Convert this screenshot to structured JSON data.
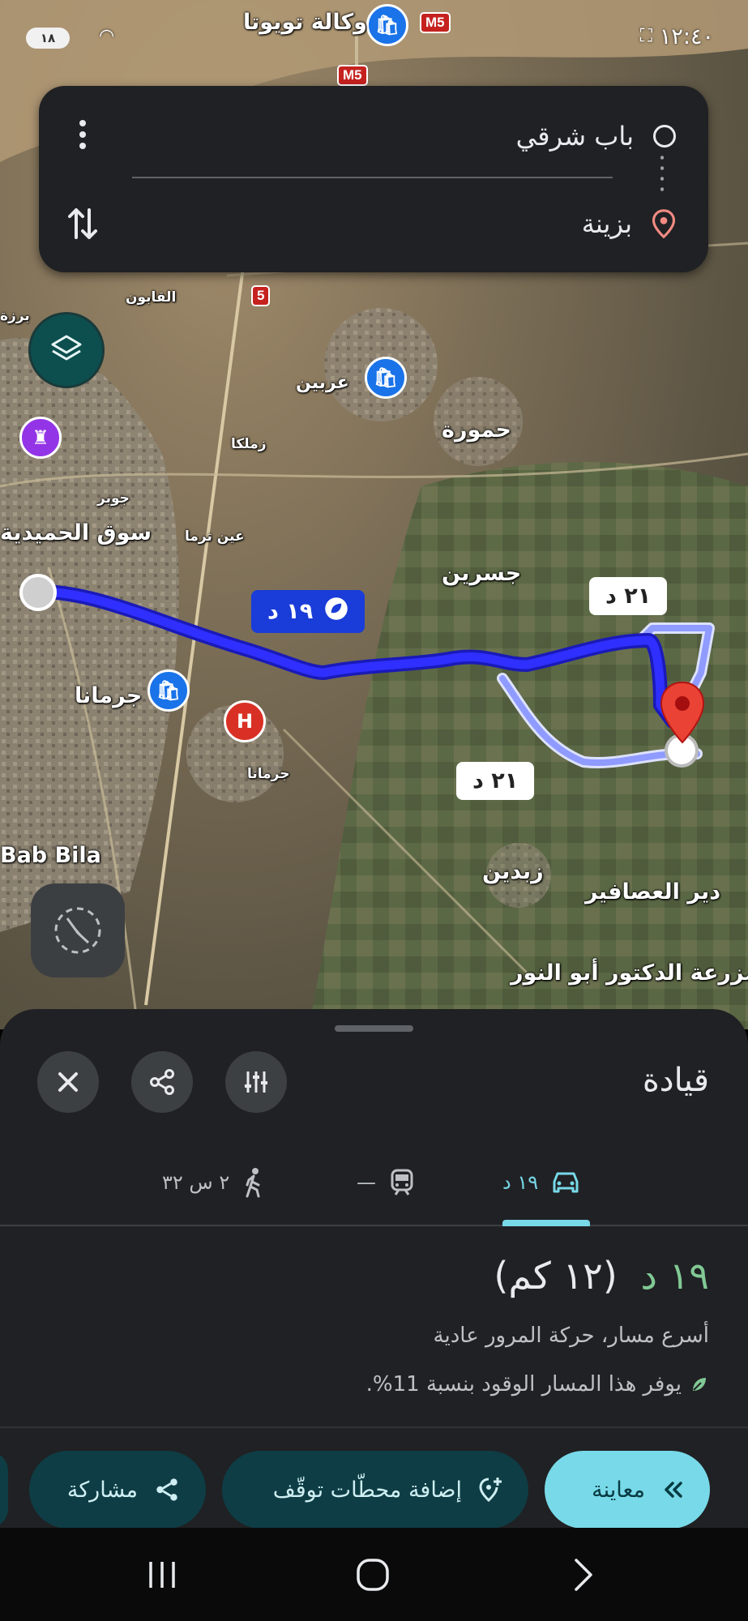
{
  "status_bar": {
    "time": "١٢:٤٠",
    "battery": "١٨"
  },
  "directions": {
    "origin": "باب شرقي",
    "destination": "بزينة",
    "more_icon": "more-vert-icon",
    "swap_icon": "swap-vertical-icon"
  },
  "map": {
    "labels": {
      "toyota": "وكالة تويوتا",
      "qaboun": "القابون",
      "arbeen": "عربين",
      "harasta": "حمورة",
      "zamalka": "زملكا",
      "jobar": "جوبر",
      "ain_tarma": "عين ترما",
      "hamidiyeh": "سوق الحميدية",
      "jisreen": "جسرين",
      "jaramana": "جرمانا",
      "jaramana_small": "جرمانا",
      "bab_bila": "Bab Bila",
      "zebdin": "زبدين",
      "deir_asafir": "دير العصافير",
      "abu_nour": "مزرعة الدكتور أبو النور",
      "barza": "برزة",
      "road_m5_top": "M5",
      "road_m5_mid": "M5",
      "road_5": "5"
    },
    "routes": {
      "main_time": "١٩ د",
      "alt_time_1": "٢١ د",
      "alt_time_2": "٢١ د"
    },
    "route_color": "#1a1ae0",
    "alt_route_color": "#8f9bff"
  },
  "sheet": {
    "title": "قيادة",
    "close_icon": "close-icon",
    "share_icon": "share-icon",
    "options_icon": "tune-icon",
    "modes": {
      "drive": {
        "icon": "car-icon",
        "value": "١٩ د"
      },
      "transit": {
        "icon": "train-icon",
        "value": "—"
      },
      "walk": {
        "icon": "walk-icon",
        "value": "٢ س ٣٢"
      }
    },
    "route": {
      "duration": "١٩ د",
      "distance": "(١٢ كم)",
      "description": "أسرع مسار، حركة المرور عادية",
      "fuel_note": "يوفر هذا المسار الوقود بنسبة 11%."
    },
    "actions": {
      "preview": "معاينة",
      "add_stops": "إضافة محطّات توقّف",
      "share": "مشاركة"
    }
  },
  "navbar": {
    "recents_icon": "recents-icon",
    "home_icon": "home-icon",
    "back_icon": "back-icon"
  }
}
